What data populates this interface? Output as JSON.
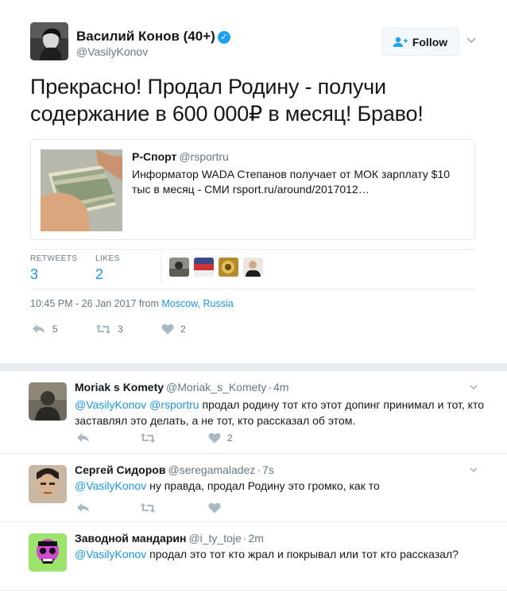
{
  "tweet": {
    "author_name": "Василий Конов (40+)",
    "author_handle": "@VasilyKonov",
    "follow_label": "Follow",
    "text": "Прекрасно! Продал Родину - получи содержание в 600 000₽ в месяц! Браво!",
    "card": {
      "source_name": "Р-Спорт",
      "source_handle": "@rsportru",
      "description": "Информатор WADA Степанов получает от МОК зарплату $10 тыс в месяц - СМИ rsport.ru/around/2017012…"
    },
    "stats": {
      "retweets_label": "RETWEETS",
      "retweets_count": "3",
      "likes_label": "LIKES",
      "likes_count": "2"
    },
    "timestamp": "10:45 PM - 26 Jan 2017 from",
    "location": "Moscow, Russia",
    "actions": {
      "reply_count": "5",
      "retweet_count": "3",
      "like_count": "2"
    }
  },
  "replies": [
    {
      "name": "Moriak s Komety",
      "handle": "@Moriak_s_Komety",
      "time": "4m",
      "mentions": "@VasilyKonov @rsportru",
      "text": " продал родину тот кто этот допинг принимал и тот, кто заставлял это делать, а не тот, кто рассказал об этом.",
      "like_count": "2"
    },
    {
      "name": "Сергей Сидоров",
      "handle": "@seregamaladez",
      "time": "7s",
      "mentions": "@VasilyKonov",
      "text": " ну правда, продал Родину это громко, как то",
      "like_count": ""
    },
    {
      "name": "Заводной мандарин",
      "handle": "@i_ty_toje",
      "time": "2m",
      "mentions": "@VasilyKonov",
      "text": " продал это тот кто жрал и покрывал или тот кто рассказал?",
      "like_count": ""
    }
  ],
  "colors": {
    "accent": "#1b95e0",
    "verified": "#1da1f2",
    "muted": "#657786",
    "divider": "#e6ecf0"
  }
}
